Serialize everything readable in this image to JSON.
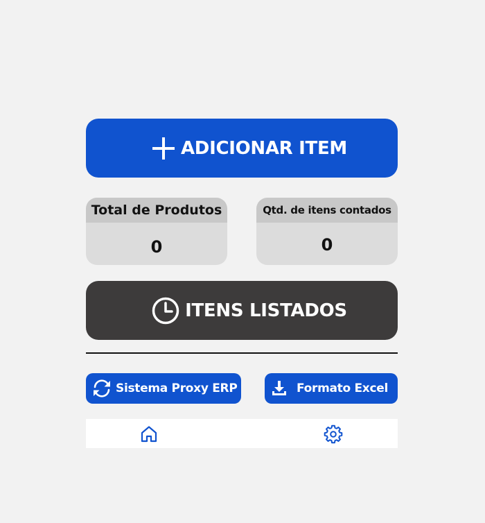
{
  "actions": {
    "add_item_label": "ADICIONAR ITEM",
    "listed_items_label": "ITENS LISTADOS"
  },
  "stats": {
    "total_products": {
      "label": "Total de Produtos",
      "value": "0"
    },
    "counted_items": {
      "label": "Qtd. de itens contados",
      "value": "0"
    }
  },
  "integrations": {
    "proxy_label": "Sistema Proxy ERP",
    "excel_label": "Formato Excel"
  },
  "nav": {
    "items": [
      {
        "icon": "home-icon"
      },
      {
        "icon": "gear-icon"
      }
    ]
  },
  "colors": {
    "primary": "#1053cf",
    "dark": "#3d3b3b",
    "card": "#dcdcdc",
    "card_header": "#c8c8c8",
    "background": "#f2f2f2"
  }
}
